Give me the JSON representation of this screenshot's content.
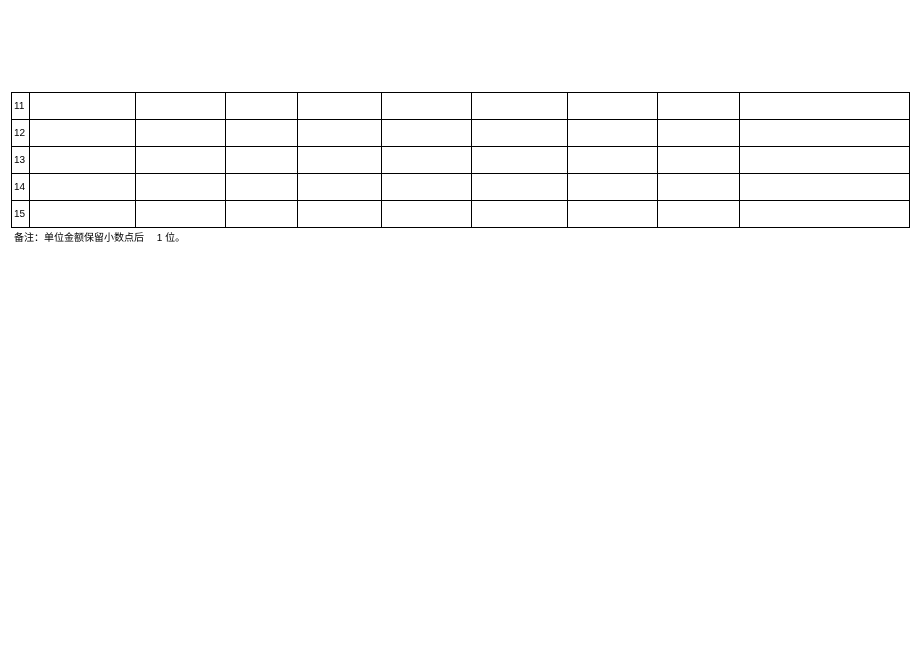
{
  "table": {
    "rows": [
      {
        "num": "11",
        "cells": [
          "",
          "",
          "",
          "",
          "",
          "",
          "",
          "",
          ""
        ]
      },
      {
        "num": "12",
        "cells": [
          "",
          "",
          "",
          "",
          "",
          "",
          "",
          "",
          ""
        ]
      },
      {
        "num": "13",
        "cells": [
          "",
          "",
          "",
          "",
          "",
          "",
          "",
          "",
          ""
        ]
      },
      {
        "num": "14",
        "cells": [
          "",
          "",
          "",
          "",
          "",
          "",
          "",
          "",
          ""
        ]
      },
      {
        "num": "15",
        "cells": [
          "",
          "",
          "",
          "",
          "",
          "",
          "",
          "",
          ""
        ]
      }
    ]
  },
  "footnote": {
    "part1": "备注：单位金额保留小数点后",
    "part2": "1 位。"
  }
}
